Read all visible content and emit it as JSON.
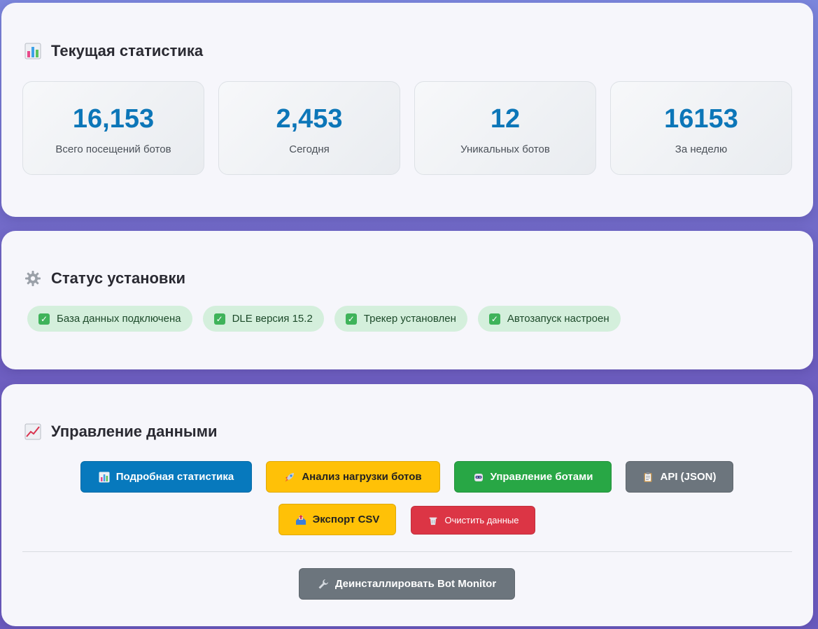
{
  "stats_section": {
    "title": "Текущая статистика",
    "icon": "bar-chart-icon",
    "items": [
      {
        "value": "16,153",
        "label": "Всего посещений ботов"
      },
      {
        "value": "2,453",
        "label": "Сегодня"
      },
      {
        "value": "12",
        "label": "Уникальных ботов"
      },
      {
        "value": "16153",
        "label": "За неделю"
      }
    ],
    "value_color": "#0c76b8"
  },
  "status_section": {
    "title": "Статус установки",
    "icon": "gear-icon",
    "items": [
      {
        "label": "База данных подключена",
        "icon": "checkmark-icon"
      },
      {
        "label": "DLE версия 15.2",
        "icon": "checkmark-icon"
      },
      {
        "label": "Трекер установлен",
        "icon": "checkmark-icon"
      },
      {
        "label": "Автозапуск настроен",
        "icon": "checkmark-icon"
      }
    ]
  },
  "data_section": {
    "title": "Управление данными",
    "icon": "line-chart-icon",
    "buttons": {
      "detailed_stats": {
        "label": "Подробная статистика",
        "icon": "bar-chart-icon",
        "color": "#0779bd"
      },
      "load_analysis": {
        "label": "Анализ нагрузки ботов",
        "icon": "rocket-icon",
        "color": "#ffc107"
      },
      "manage_bots": {
        "label": "Управление ботами",
        "icon": "robot-icon",
        "color": "#28a745"
      },
      "api_json": {
        "label": "API (JSON)",
        "icon": "clipboard-icon",
        "color": "#6c757d"
      },
      "export_csv": {
        "label": "Экспорт CSV",
        "icon": "outbox-icon",
        "color": "#ffc107"
      },
      "clear_data": {
        "label": "Очистить данные",
        "icon": "trash-icon",
        "color": "#dc3545"
      },
      "uninstall": {
        "label": "Деинсталлировать Bot Monitor",
        "icon": "wrench-icon",
        "color": "#6c757d"
      }
    }
  }
}
